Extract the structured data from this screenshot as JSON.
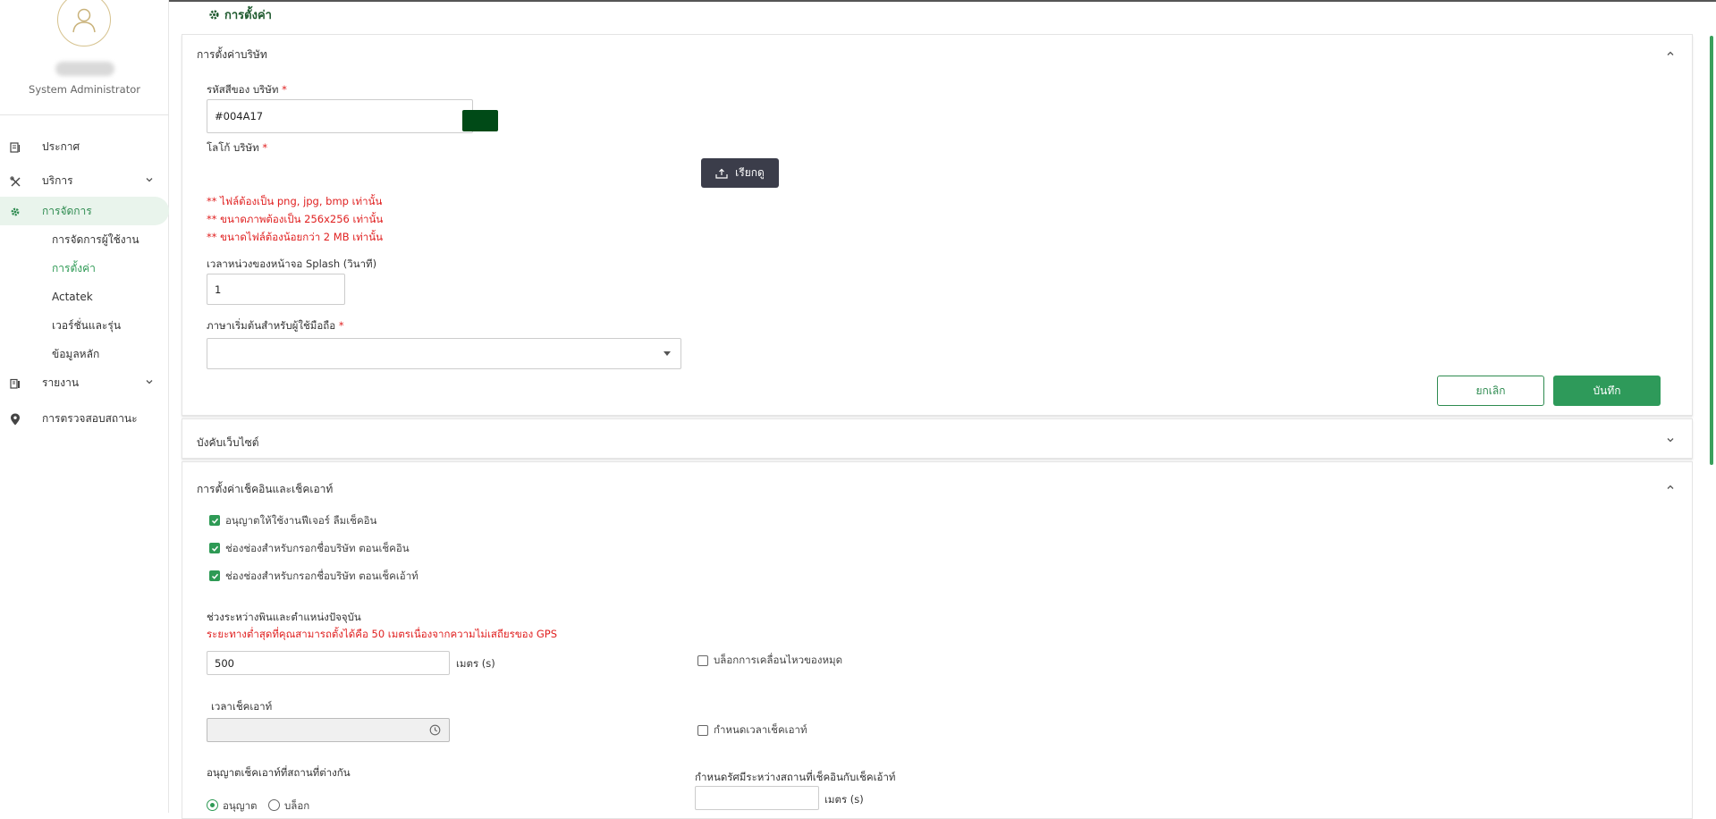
{
  "sidebar": {
    "user_role": "System Administrator",
    "nav": [
      {
        "label": "ประกาศ",
        "icon": "announcement-icon"
      },
      {
        "label": "บริการ",
        "icon": "tools-icon"
      },
      {
        "label": "การจัดการ",
        "icon": "gear-icon"
      },
      {
        "label": "รายงาน",
        "icon": "report-icon"
      },
      {
        "label": "การตรวจสอบสถานะ",
        "icon": "location-pin-icon"
      }
    ],
    "sub": [
      {
        "label": "การจัดการผู้ใช้งาน"
      },
      {
        "label": "การตั้งค่า"
      },
      {
        "label": "Actatek"
      },
      {
        "label": "เวอร์ชั่นและรุ่น"
      },
      {
        "label": "ข้อมูลหลัก"
      }
    ]
  },
  "page": {
    "title": "การตั้งค่า"
  },
  "company": {
    "section_title": "การตั้งค่าบริษัท",
    "color_label": "รหัสสีของ บริษัท",
    "color_value": "#004A17",
    "logo_label": "โลโก้ บริษัท",
    "browse_label": "เรียกดู",
    "warnings": [
      "** ไฟล์ต้องเป็น png, jpg, bmp เท่านั้น",
      "** ขนาดภาพต้องเป็น 256x256 เท่านั้น",
      "** ขนาดไฟล์ต้องน้อยกว่า 2 MB เท่านั้น"
    ],
    "splash_label": "เวลาหน่วงของหน้าจอ Splash (วินาที)",
    "splash_value": "1",
    "language_label": "ภาษาเริ่มต้นสำหรับผู้ใช้มือถือ",
    "language_value": "",
    "cancel_label": "ยกเลิก",
    "save_label": "บันทึก"
  },
  "force_website": {
    "section_title": "บังคับเว็บไซต์"
  },
  "checkinout": {
    "section_title": "การตั้งค่าเช็คอินและเช็คเอาท์",
    "checkboxes": [
      {
        "label": "อนุญาตให้ใช้งานฟีเจอร์ ลืมเช็คอิน",
        "checked": true
      },
      {
        "label": "ช่องช่องสำหรับกรอกชื่อบริษัท ตอนเช็คอิน",
        "checked": true
      },
      {
        "label": "ช่องช่องสำหรับกรอกชื่อบริษัท ตอนเช็คเอ้าท์",
        "checked": true
      }
    ],
    "distance_label": "ช่วงระหว่างพินและตำแหน่งปัจจุบัน",
    "distance_warning": "ระยะทางต่ำสุดที่คุณสามารถตั้งได้คือ 50 เมตรเนื่องจากความไม่เสถียรของ GPS",
    "distance_value": "500",
    "distance_unit": "เมตร (s)",
    "block_pin_label": "บล็อกการเคลื่อนไหวของหมุด",
    "checkout_time_label": "เวลาเช็คเอาท์",
    "checkout_time_value": "",
    "set_checkout_time_label": "กำหนดเวลาเช็คเอาท์",
    "allow_diff_label": "อนุญาตเช็คเอาท์ที่สถานที่ต่างกัน",
    "allow_option": "อนุญาต",
    "block_option": "บล็อก",
    "radius_label": "กำหนดรัศมีระหว่างสถานที่เช็คอินกับเช็คเอ้าท์",
    "radius_value": "",
    "radius_unit": "เมตร (s)"
  }
}
